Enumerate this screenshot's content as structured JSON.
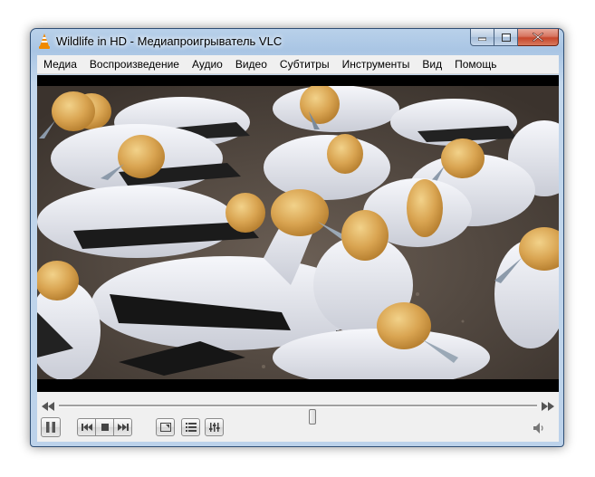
{
  "window": {
    "title": "Wildlife in HD - Медиапроигрыватель VLC",
    "icon": "vlc-cone-icon"
  },
  "menubar": {
    "items": [
      {
        "label": "Медиа"
      },
      {
        "label": "Воспроизведение"
      },
      {
        "label": "Аудио"
      },
      {
        "label": "Видео"
      },
      {
        "label": "Субтитры"
      },
      {
        "label": "Инструменты"
      },
      {
        "label": "Вид"
      },
      {
        "label": "Помощь"
      }
    ]
  },
  "player": {
    "seek_fraction": 0.53,
    "state": "paused"
  },
  "icons": {
    "minimize": "minimize-icon",
    "maximize": "maximize-icon",
    "close": "close-icon",
    "play_pause": "pause-icon",
    "previous": "skip-previous-icon",
    "stop": "stop-icon",
    "next": "skip-next-icon",
    "fullscreen": "fullscreen-icon",
    "playlist": "playlist-icon",
    "extended": "equalizer-icon",
    "volume": "volume-icon"
  },
  "colors": {
    "title_bar": "#b9d1ea",
    "close_button": "#c7462b",
    "vlc_orange": "#f08a00"
  }
}
